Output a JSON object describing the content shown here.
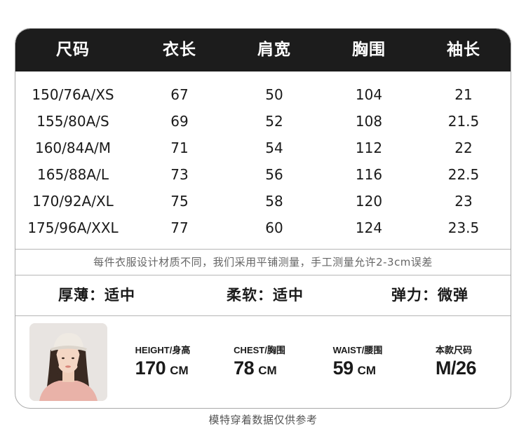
{
  "table": {
    "headers": [
      "尺码",
      "衣长",
      "肩宽",
      "胸围",
      "袖长"
    ],
    "rows": [
      [
        "150/76A/XS",
        "67",
        "50",
        "104",
        "21"
      ],
      [
        "155/80A/S",
        "69",
        "52",
        "108",
        "21.5"
      ],
      [
        "160/84A/M",
        "71",
        "54",
        "112",
        "22"
      ],
      [
        "165/88A/L",
        "73",
        "56",
        "116",
        "22.5"
      ],
      [
        "170/92A/XL",
        "75",
        "58",
        "120",
        "23"
      ],
      [
        "175/96A/XXL",
        "77",
        "60",
        "124",
        "23.5"
      ]
    ]
  },
  "note": "每件衣服设计材质不同，我们采用平铺测量，手工测量允许2-3cm误差",
  "properties": {
    "thickness": "厚薄：适中",
    "softness": "柔软：适中",
    "elasticity": "弹力：微弹"
  },
  "model": {
    "height": {
      "label": "HEIGHT/身高",
      "value": "170",
      "unit": "CM"
    },
    "chest": {
      "label": "CHEST/胸围",
      "value": "78",
      "unit": "CM"
    },
    "waist": {
      "label": "WAIST/腰围",
      "value": "59",
      "unit": "CM"
    },
    "size": {
      "label": "本款尺码",
      "value": "M/26"
    }
  },
  "footer": "模特穿着数据仅供参考",
  "colors": {
    "header_bg": "#1c1c1c",
    "header_text": "#ffffff",
    "border": "#a9a9a9",
    "note_text": "#666666"
  }
}
